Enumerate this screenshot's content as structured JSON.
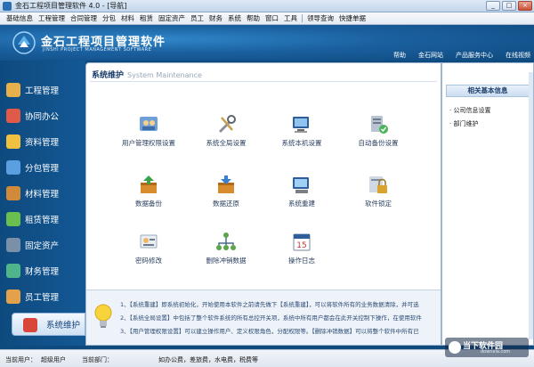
{
  "window": {
    "title": "金石工程项目管理软件 4.0 - [导航]",
    "controls": [
      "_",
      "□",
      "×"
    ]
  },
  "menu": {
    "items": [
      "基础信息",
      "工程管理",
      "合同管理",
      "分包",
      "材料",
      "租赁",
      "固定资产",
      "员工",
      "财务",
      "系统",
      "帮助",
      "窗口",
      "工具"
    ],
    "extra": [
      "领导查询",
      "快捷单据"
    ]
  },
  "banner": {
    "brand_cn": "金石工程项目管理软件",
    "brand_en": "JINSHI PROJECT MANAGEMENT SOFTWARE",
    "links": [
      "帮助",
      "金石网站",
      "产品服务中心",
      "在线视频"
    ]
  },
  "sidebar": {
    "items": [
      {
        "label": "工程管理",
        "color": "#e8b04a"
      },
      {
        "label": "协同办公",
        "color": "#e05a4a"
      },
      {
        "label": "资料管理",
        "color": "#f0c040"
      },
      {
        "label": "分包管理",
        "color": "#5aa0e0"
      },
      {
        "label": "材料管理",
        "color": "#d08a3a"
      },
      {
        "label": "租赁管理",
        "color": "#6bbf4e"
      },
      {
        "label": "固定资产",
        "color": "#7a8fa8"
      },
      {
        "label": "财务管理",
        "color": "#4fb58a"
      },
      {
        "label": "员工管理",
        "color": "#e3a24a"
      },
      {
        "label": "系统维护",
        "color": "#d8473a"
      }
    ],
    "active_index": 9
  },
  "content": {
    "title": "系统维护",
    "title_en": "System Maintenance",
    "tools": [
      {
        "label": "用户管理权限设置",
        "icon": "users-icon"
      },
      {
        "label": "系统全局设置",
        "icon": "tools-icon"
      },
      {
        "label": "系统本机设置",
        "icon": "computer-icon"
      },
      {
        "label": "自动备份设置",
        "icon": "server-check-icon"
      },
      {
        "label": "数据备份",
        "icon": "database-backup-icon"
      },
      {
        "label": "数据还原",
        "icon": "database-restore-icon"
      },
      {
        "label": "系统重建",
        "icon": "monitor-rebuild-icon"
      },
      {
        "label": "软件锁定",
        "icon": "lock-icon"
      },
      {
        "label": "密码修改",
        "icon": "password-icon"
      },
      {
        "label": "删除冲销数据",
        "icon": "network-icon"
      },
      {
        "label": "操作日志",
        "icon": "calendar-log-icon"
      }
    ],
    "tips": [
      "1、【系统重建】即系统初始化，开始使用本软件之前请先做下【系统重建】，可以将软件所有的业务数据清除，并可选",
      "2、【系统全局设置】中包括了整个软件系统的所有总控开关项，系统中所有用户都会在此开关控制下操作，在使用软件",
      "3、【用户管理权限设置】可以建立操作用户、定义权限角色，分配权限等。【删除冲销数据】可以将整个软件中所有已"
    ]
  },
  "right_panel": {
    "title": "相关基本信息",
    "items": [
      "公司信息设置",
      "部门维护"
    ]
  },
  "status": {
    "user_label": "当前用户：",
    "user_value": "超级用户",
    "dept_label": "当前部门：",
    "expenses": "如办公费，差旅费，水电费，税费等"
  },
  "watermark": {
    "text": "当下软件园",
    "sub": "downxia.com"
  }
}
